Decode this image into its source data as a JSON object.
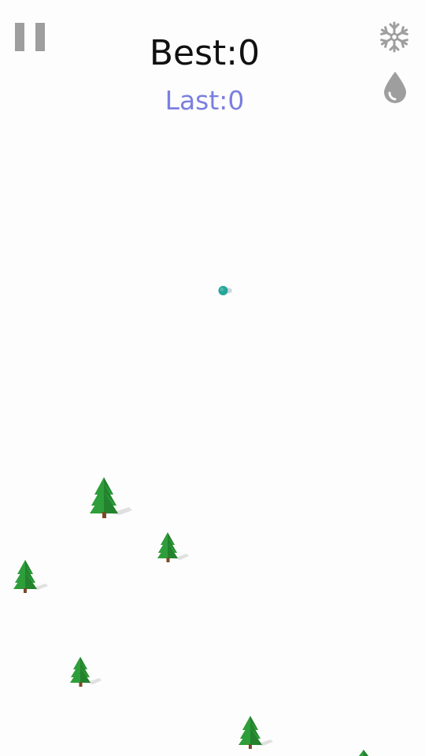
{
  "hud": {
    "best_label": "Best:0",
    "last_label": "Last:0",
    "last_color": "#7b7fe0",
    "icon_color": "#9e9e9e"
  },
  "controls": {
    "pause_icon": "pause-icon",
    "snow_icon": "snowflake-icon",
    "drop_icon": "droplet-icon"
  },
  "skier": {
    "color": "#26a69a"
  },
  "trees": {
    "foliage_color": "#2e9e3a",
    "trunk_color": "#7a4a2a",
    "count": 7
  }
}
